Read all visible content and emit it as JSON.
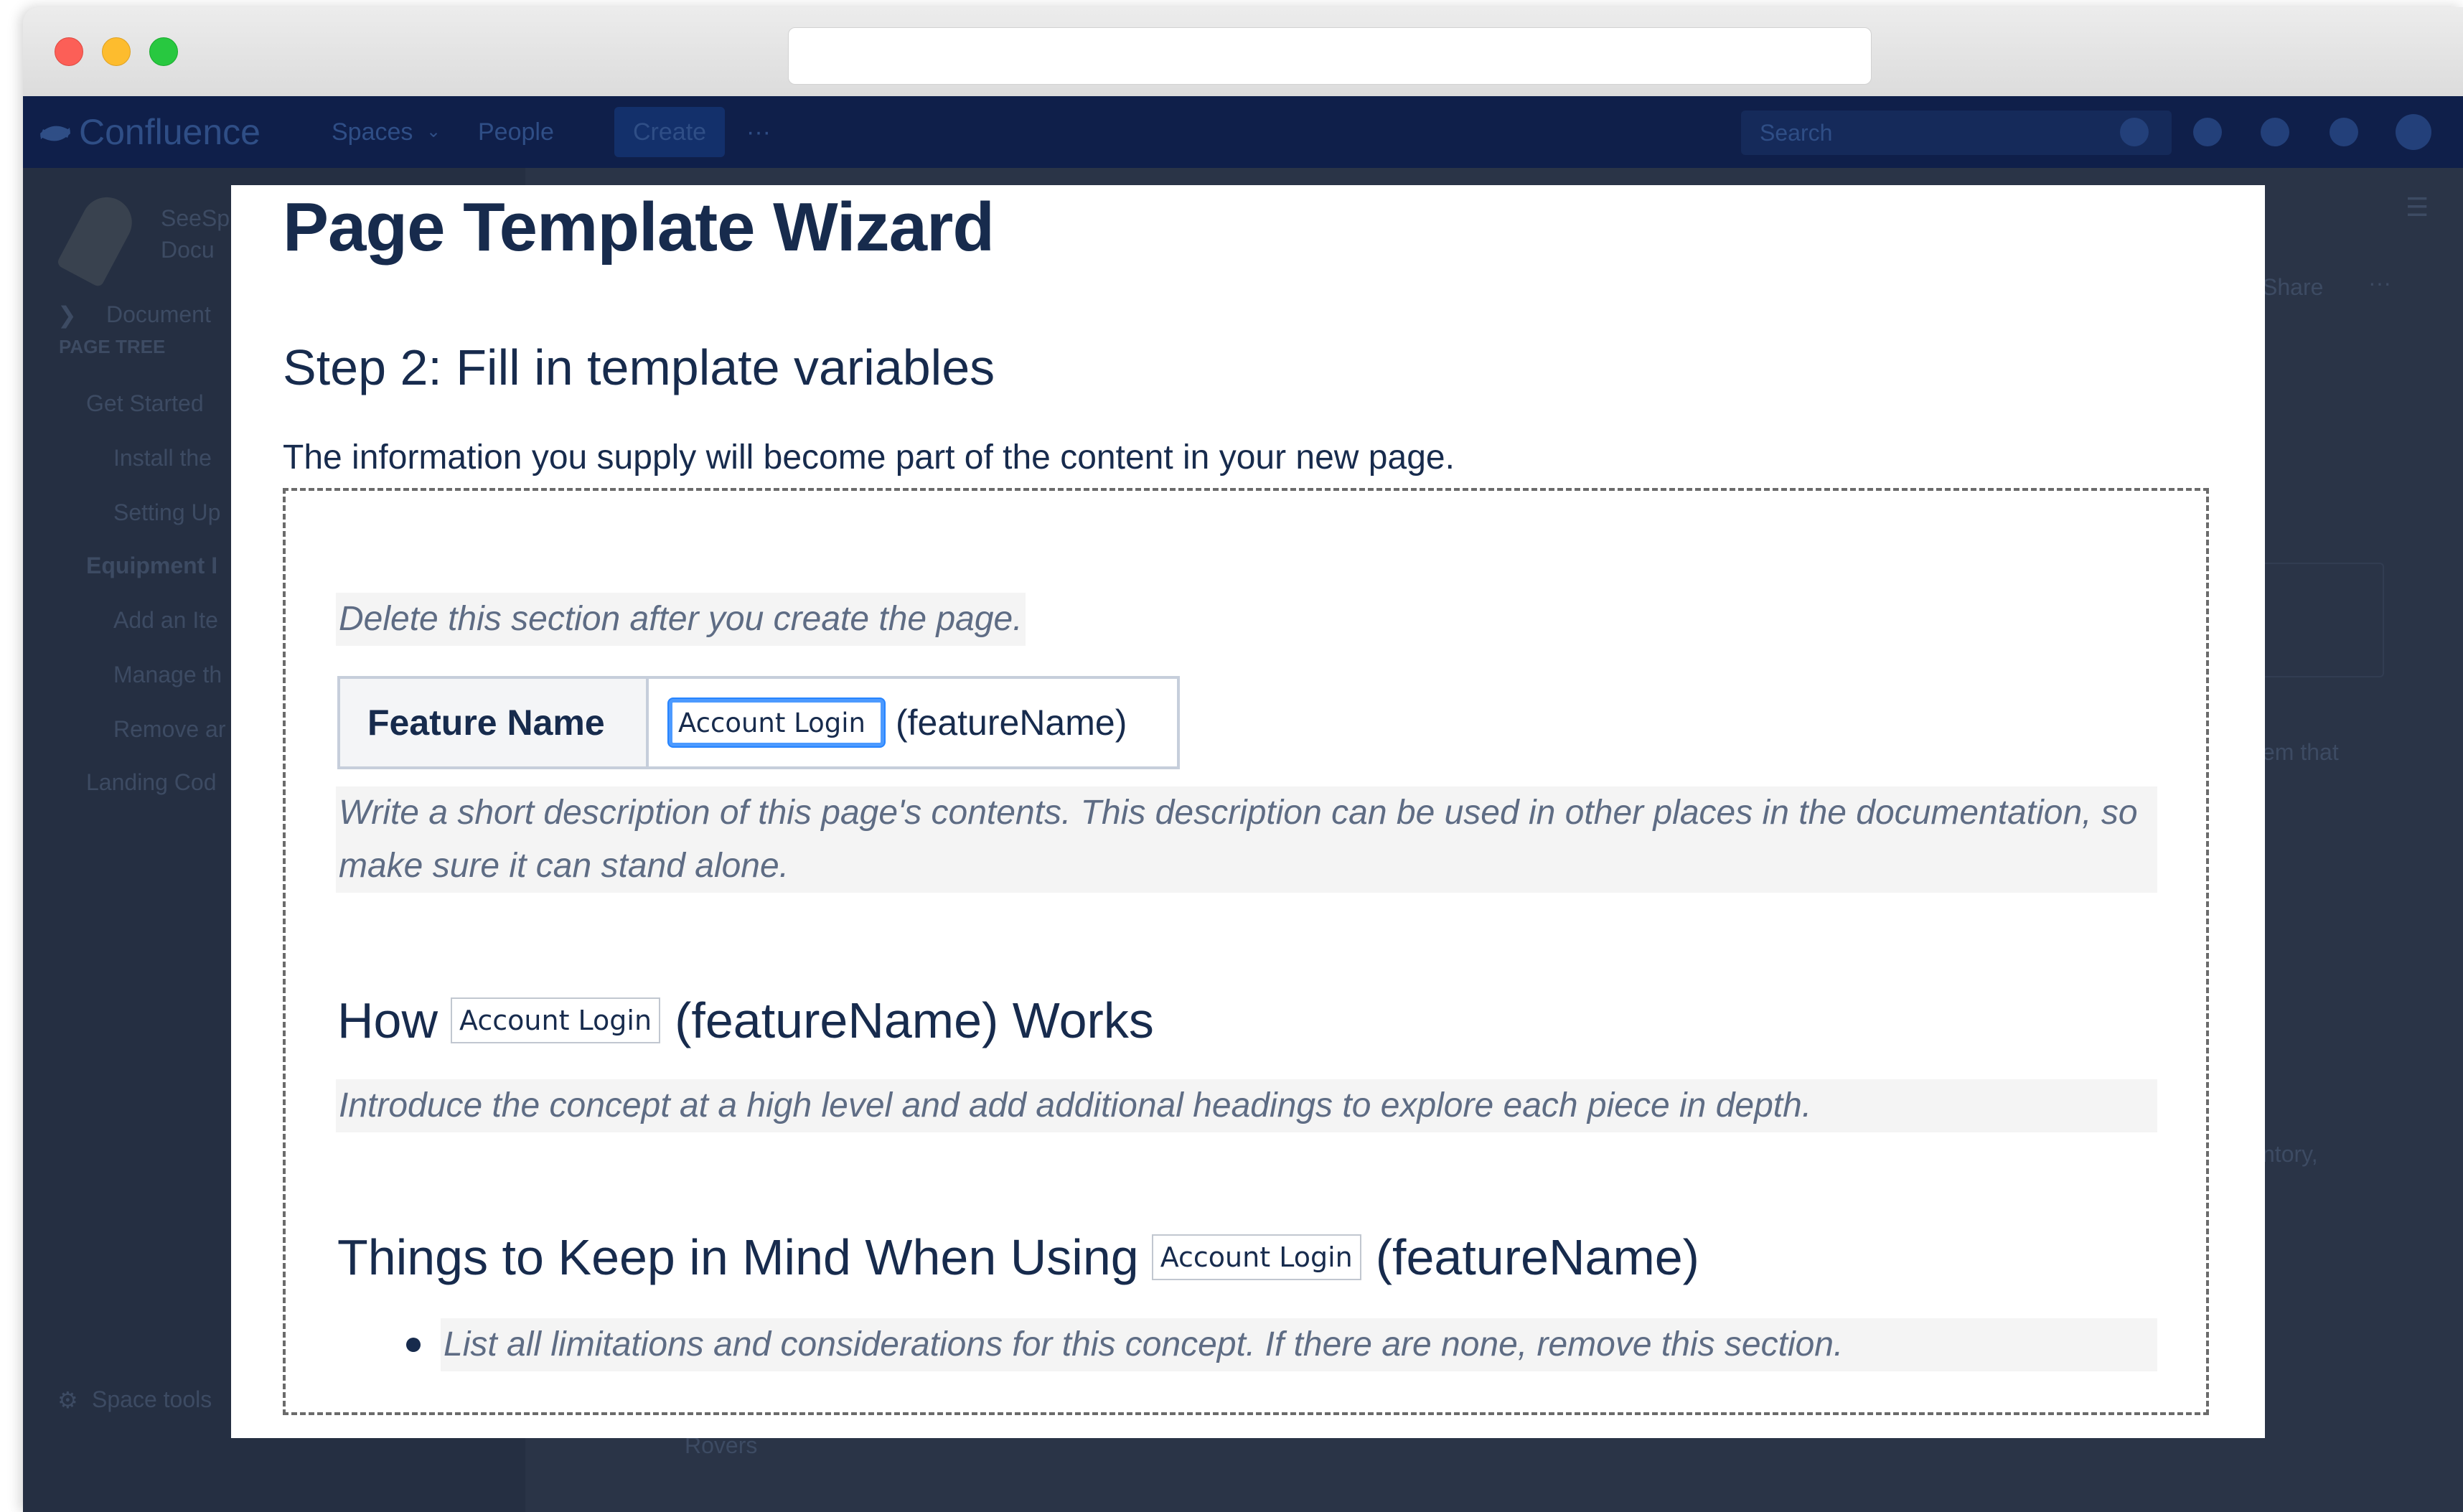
{
  "app": {
    "brand": "Confluence",
    "nav": {
      "spaces": "Spaces",
      "people": "People",
      "create": "Create",
      "more": "···",
      "search_placeholder": "Search"
    },
    "sidebar": {
      "space_name_line1": "SeeSp",
      "space_name_line2": "Docu",
      "documentation": "Document",
      "page_tree_label": "PAGE TREE",
      "tree": [
        "Get Started",
        "Install the",
        "Setting Up",
        "Equipment I",
        "Add an Ite",
        "Manage th",
        "Remove ar",
        "Landing Cod"
      ],
      "space_tools": "Space tools",
      "collapse": "«"
    },
    "main_fragments": {
      "share": "Share",
      "more": "···",
      "frag1": "em that",
      "frag2": "ntory,",
      "frag3": "Rovers"
    }
  },
  "wizard": {
    "title": "Page Template Wizard",
    "step": "Step 2: Fill in template variables",
    "intro": "The information you supply will become part of the content in your new page.",
    "delete_note": "Delete this section after you create the page.",
    "variable": {
      "label": "Feature Name",
      "value": "Account Login",
      "key": "(featureName)"
    },
    "description_note": "Write a short description of this page's contents. This description can be used in other places in the documentation, so make sure it can stand alone.",
    "how_heading": {
      "prefix": "How",
      "value": "Account Login",
      "suffix": "(featureName) Works"
    },
    "concept_note": "Introduce the concept at a high level and add additional headings to explore each piece in depth.",
    "things_heading": {
      "prefix": "Things to Keep in Mind When Using",
      "value": "Account Login",
      "suffix": "(featureName)"
    },
    "limitations_note": "List all limitations and considerations for this concept. If there are none, remove this section."
  },
  "colors": {
    "heading": "#172b4d",
    "instruction_bg": "#f4f4f4",
    "focus_ring": "#4c9aff",
    "confluence_nav": "#0f1f4a"
  }
}
